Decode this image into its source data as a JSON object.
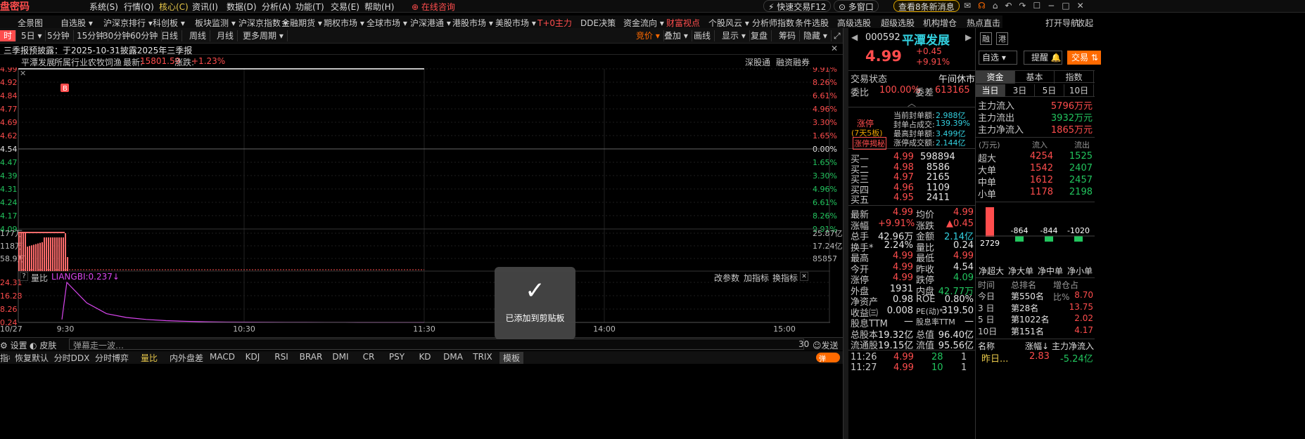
{
  "app": {
    "logo": "盘密码",
    "online": "在线咨询",
    "quick_trade": "快速交易F12",
    "multi_window": "多窗口",
    "news_button": "查看8条新消息"
  },
  "menu": [
    "系统(S)",
    "行情(Q)",
    "核心(C)",
    "资讯(I)",
    "数据(D)",
    "分析(A)",
    "功能(T)",
    "交易(E)",
    "帮助(H)"
  ],
  "nav": [
    "全景图",
    "自选股 ▾",
    "沪深京排行 ▾",
    "科创板 ▾",
    "板块监测 ▾",
    "沪深京指数 ▾",
    "金融期货 ▾",
    "期权市场 ▾",
    "全球市场 ▾",
    "沪深港通 ▾",
    "港股市场 ▾",
    "美股市场 ▾",
    "T+0主力",
    "DDE决策",
    "资金流向 ▾",
    "财富视点",
    "个股风云 ▾",
    "分析师指数",
    "条件选股",
    "高级选股",
    "超级选股",
    "机构增仓",
    "热点直击",
    "打开导航",
    "收起"
  ],
  "toolbar": {
    "periods": [
      "时",
      "5日 ▾",
      "5分钟",
      "15分钟",
      "30分钟",
      "60分钟",
      "日线",
      "周线",
      "月线",
      "更多周期 ▾"
    ],
    "right": [
      "竞价 ▾",
      "叠加 ▾",
      "画线",
      "显示 ▾",
      "复盘",
      "筹码",
      "隐藏 ▾"
    ]
  },
  "notice": "三季报预披露：于2025-10-31披露2025年三季报",
  "chart_header": {
    "name": "平潭发展",
    "industry_label": "所属行业:",
    "industry": "农牧饲渔",
    "latest_label": "最新:",
    "latest": "15801.59",
    "change_label": "涨跌:",
    "change": "+1.23%",
    "links": [
      "深股通",
      "融资融券"
    ]
  },
  "indicator": {
    "name": "量比",
    "value": "LIANGBI:0.237↓",
    "actions": [
      "改参数",
      "加指标",
      "换指标"
    ]
  },
  "bottom_bar": {
    "settings": "设置",
    "skin": "皮肤",
    "danmu": "弹幕走一波…",
    "count": "30",
    "send": "发送",
    "tabs": [
      "指标",
      "恢复默认",
      "分时DDX",
      "分时博弈",
      "量比",
      "内外盘差",
      "MACD",
      "KDJ",
      "RSI",
      "BRAR",
      "DMI",
      "CR",
      "PSY",
      "KD",
      "DMA",
      "TRIX",
      "模板"
    ],
    "toggle": "弹"
  },
  "toast": "已添加到剪贴板",
  "chart_data": {
    "type": "line",
    "x_ticks": [
      "10/27",
      "9:30",
      "10:30",
      "11:30",
      "14:00",
      "15:00"
    ],
    "price_axis_left": [
      "4.99",
      "4.92",
      "4.84",
      "4.77",
      "4.69",
      "4.62",
      "4.54",
      "4.47",
      "4.39",
      "4.31",
      "4.24",
      "4.17",
      "4.09"
    ],
    "price_axis_right": [
      "9.91%",
      "8.26%",
      "6.61%",
      "4.96%",
      "3.30%",
      "1.65%",
      "0.00%",
      "1.65%",
      "3.30%",
      "4.96%",
      "6.61%",
      "8.26%",
      "9.91%"
    ],
    "volume_axis_left": [
      "177万",
      "118万",
      "58.9万"
    ],
    "volume_axis_right": [
      "25.87亿",
      "17.24亿",
      "85857"
    ],
    "indicator_axis": [
      "24.31",
      "16.28",
      "8.26",
      "0.24"
    ],
    "price_series": [
      4.99,
      4.99,
      4.99
    ],
    "indicator_series": [
      2.0,
      24.31,
      12.0,
      5.5,
      3.2,
      2.0,
      1.3,
      0.9,
      0.6,
      0.45,
      0.4,
      0.35,
      0.3,
      0.28,
      0.27,
      0.26,
      0.25,
      0.24,
      0.24,
      0.24
    ]
  },
  "stock": {
    "code": "000592",
    "name": "平潭发展",
    "price": "4.99",
    "chg": "+0.45",
    "pct": "+9.91%",
    "btn_zixuan": "自选 ▾",
    "btn_remind": "提醒",
    "btn_trade": "交易",
    "tag1": "融",
    "tag2": "港",
    "status_label": "交易状态",
    "status": "午间休市",
    "weibi_label": "委比",
    "weibi": "100.00%",
    "weicha_label": "委差",
    "weicha": "613165",
    "limit": {
      "title": "涨停",
      "sub": "(7天5板)",
      "reveal": "涨停揭秘",
      "rows": [
        [
          "当前封单额:",
          "2.988亿"
        ],
        [
          "封单占成交:",
          "139.39%"
        ],
        [
          "最高封单额:",
          "3.499亿"
        ],
        [
          "涨停成交额:",
          "2.144亿"
        ]
      ]
    },
    "bids": [
      [
        "买一",
        "4.99",
        "598894"
      ],
      [
        "买二",
        "4.98",
        "8586"
      ],
      [
        "买三",
        "4.97",
        "2165"
      ],
      [
        "买四",
        "4.96",
        "1109"
      ],
      [
        "买五",
        "4.95",
        "2411"
      ]
    ],
    "stats": [
      [
        "最新",
        "4.99",
        "均价",
        "4.99"
      ],
      [
        "涨幅",
        "+9.91%",
        "涨跌",
        "▲0.45"
      ],
      [
        "总手",
        "42.96万",
        "金额",
        "2.14亿"
      ],
      [
        "换手*",
        "2.24%",
        "量比",
        "0.24"
      ],
      [
        "最高",
        "4.99",
        "最低",
        "4.99"
      ],
      [
        "今开",
        "4.99",
        "昨收",
        "4.54"
      ],
      [
        "涨停",
        "4.99",
        "跌停",
        "4.09"
      ],
      [
        "外盘",
        "1931",
        "内盘",
        "42.77万"
      ],
      [
        "净资产",
        "0.98",
        "ROE",
        "0.80%"
      ],
      [
        "收益㈢",
        "0.008",
        "PE(动)*",
        "319.50"
      ],
      [
        "股息TTM",
        "—",
        "股息率TTM",
        "—"
      ],
      [
        "总股本",
        "19.32亿",
        "总值",
        "96.40亿"
      ],
      [
        "流通股",
        "19.15亿",
        "流值",
        "95.56亿"
      ]
    ],
    "ticks": [
      [
        "11:26",
        "4.99",
        "28",
        "1"
      ],
      [
        "11:27",
        "4.99",
        "10",
        "1"
      ]
    ]
  },
  "fund": {
    "tabs": [
      "资金",
      "基本",
      "指数"
    ],
    "subtabs": [
      "当日",
      "3日",
      "5日",
      "10日"
    ],
    "main": [
      [
        "主力流入",
        "5796万元"
      ],
      [
        "主力流出",
        "3932万元"
      ],
      [
        "主力净流入",
        "1865万元"
      ]
    ],
    "unit": "(万元)",
    "hdr_in": "流入",
    "hdr_out": "流出",
    "rows": [
      [
        "超大",
        "4254",
        "1525"
      ],
      [
        "大单",
        "1542",
        "2407"
      ],
      [
        "中单",
        "1612",
        "2457"
      ],
      [
        "小单",
        "1178",
        "2198"
      ]
    ],
    "net": [
      {
        "label": "净超大",
        "value": 2729
      },
      {
        "label": "净大单",
        "value": -864
      },
      {
        "label": "净中单",
        "value": -844
      },
      {
        "label": "净小单",
        "value": -1020
      }
    ],
    "rank_hdr": [
      "时间",
      "总排名",
      "增仓占比%"
    ],
    "rank": [
      [
        "今日",
        "第550名",
        "8.70"
      ],
      [
        "3 日",
        "第28名",
        "13.75"
      ],
      [
        "5 日",
        "第1022名",
        "2.02"
      ],
      [
        "10日",
        "第151名",
        "4.17"
      ]
    ],
    "list_hdr": [
      "名称",
      "涨幅↓",
      "主力净流入"
    ],
    "list": [
      [
        "昨日...",
        "2.83",
        "-5.24亿"
      ]
    ]
  }
}
